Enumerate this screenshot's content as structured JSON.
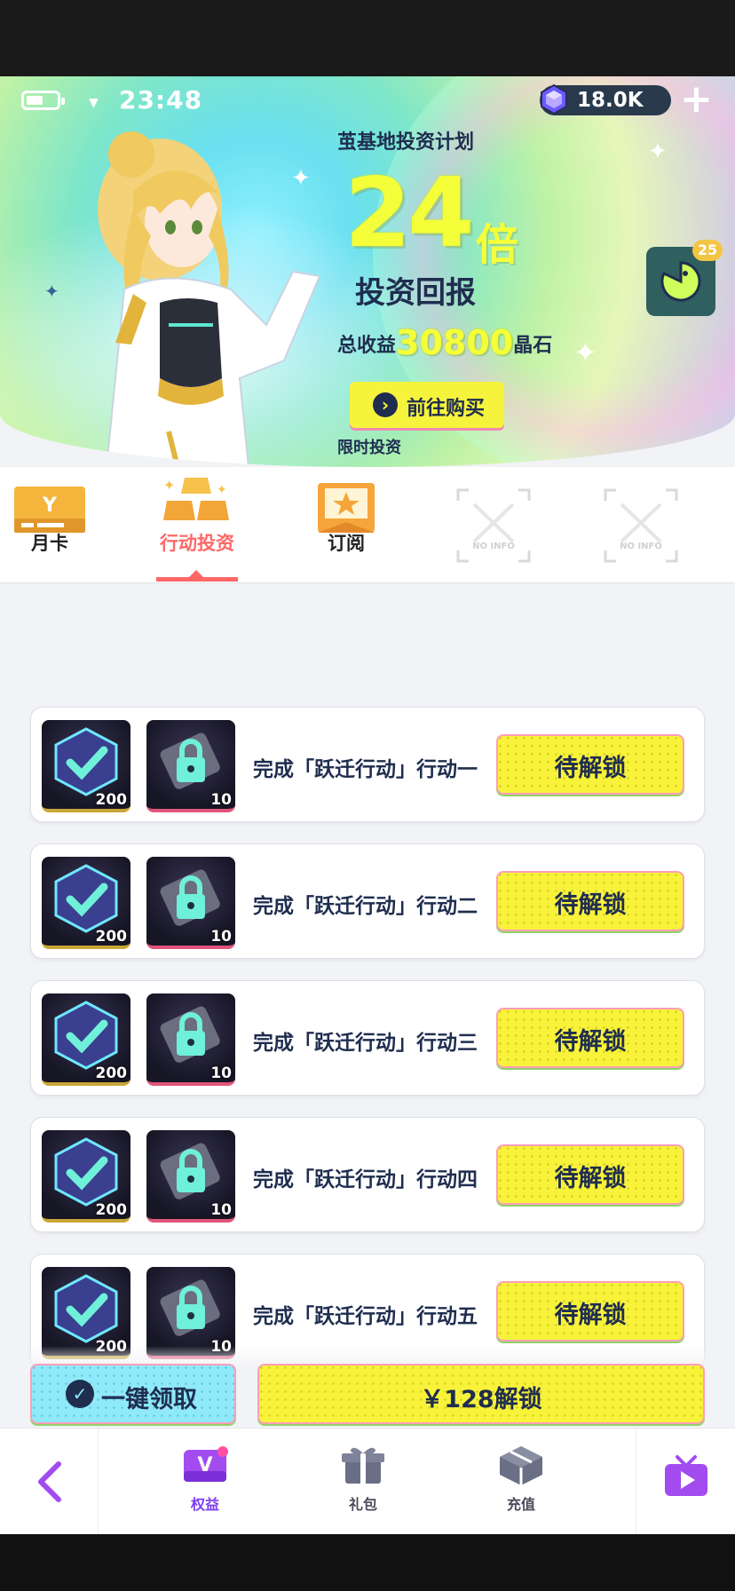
{
  "status": {
    "time": "23:48",
    "currency_amount": "18.0K"
  },
  "banner": {
    "plan_title": "茧基地投资计划",
    "multiplier_number": "24",
    "multiplier_suffix": "倍",
    "return_label": "投资回报",
    "total_prefix": "总收益",
    "total_value": "30800",
    "total_unit": "晶石",
    "buy_label": "前往购买",
    "limited_label": "限时投资",
    "side_badge": "25"
  },
  "tabs": [
    {
      "label": "月卡",
      "active": false
    },
    {
      "label": "行动投资",
      "active": true
    },
    {
      "label": "订阅",
      "active": false
    },
    {
      "label": "NO INFO",
      "active": false
    },
    {
      "label": "NO INFO",
      "active": false
    }
  ],
  "tasks": [
    {
      "text": "完成「跃迁行动」行动一",
      "reward1_count": "200",
      "reward2_count": "10",
      "button": "待解锁"
    },
    {
      "text": "完成「跃迁行动」行动二",
      "reward1_count": "200",
      "reward2_count": "10",
      "button": "待解锁"
    },
    {
      "text": "完成「跃迁行动」行动三",
      "reward1_count": "200",
      "reward2_count": "10",
      "button": "待解锁"
    },
    {
      "text": "完成「跃迁行动」行动四",
      "reward1_count": "200",
      "reward2_count": "10",
      "button": "待解锁"
    },
    {
      "text": "完成「跃迁行动」行动五",
      "reward1_count": "200",
      "reward2_count": "10",
      "button": "待解锁"
    }
  ],
  "actions": {
    "claim_all": "一键领取",
    "unlock_price": "￥128解锁"
  },
  "bottom_nav": [
    {
      "label": "权益",
      "icon": "vip-icon",
      "active": true
    },
    {
      "label": "礼包",
      "icon": "gift-icon",
      "active": false
    },
    {
      "label": "充值",
      "icon": "cube-icon",
      "active": false
    }
  ],
  "colors": {
    "accent_yellow": "#f8f33a",
    "accent_cyan": "#8fe9f8",
    "navy_text": "#1f2d4f",
    "tab_active": "#ff6767",
    "nav_active": "#7b3df0"
  }
}
